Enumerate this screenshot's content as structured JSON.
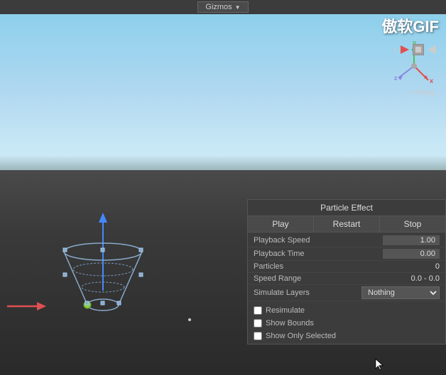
{
  "topbar": {
    "gizmos_label": "Gizmos",
    "gizmos_arrow": "▼"
  },
  "watermark": {
    "text": "傲软GIF"
  },
  "viewport": {
    "persp_label": "< Persp"
  },
  "particle_panel": {
    "title": "Particle Effect",
    "buttons": {
      "play": "Play",
      "restart": "Restart",
      "stop": "Stop"
    },
    "fields": {
      "playback_speed_label": "Playback Speed",
      "playback_speed_value": "1.00",
      "playback_time_label": "Playback Time",
      "playback_time_value": "0.00",
      "particles_label": "Particles",
      "particles_value": "0",
      "speed_range_label": "Speed Range",
      "speed_range_value": "0.0 - 0.0",
      "simulate_layers_label": "Simulate Layers",
      "simulate_layers_value": "Nothing"
    },
    "checkboxes": {
      "resimulate_label": "Resimulate",
      "show_bounds_label": "Show Bounds",
      "show_only_selected_label": "Show Only Selected"
    }
  },
  "gizmo": {
    "x_color": "#e05050",
    "y_color": "#50c050",
    "z_color": "#5050e0"
  }
}
